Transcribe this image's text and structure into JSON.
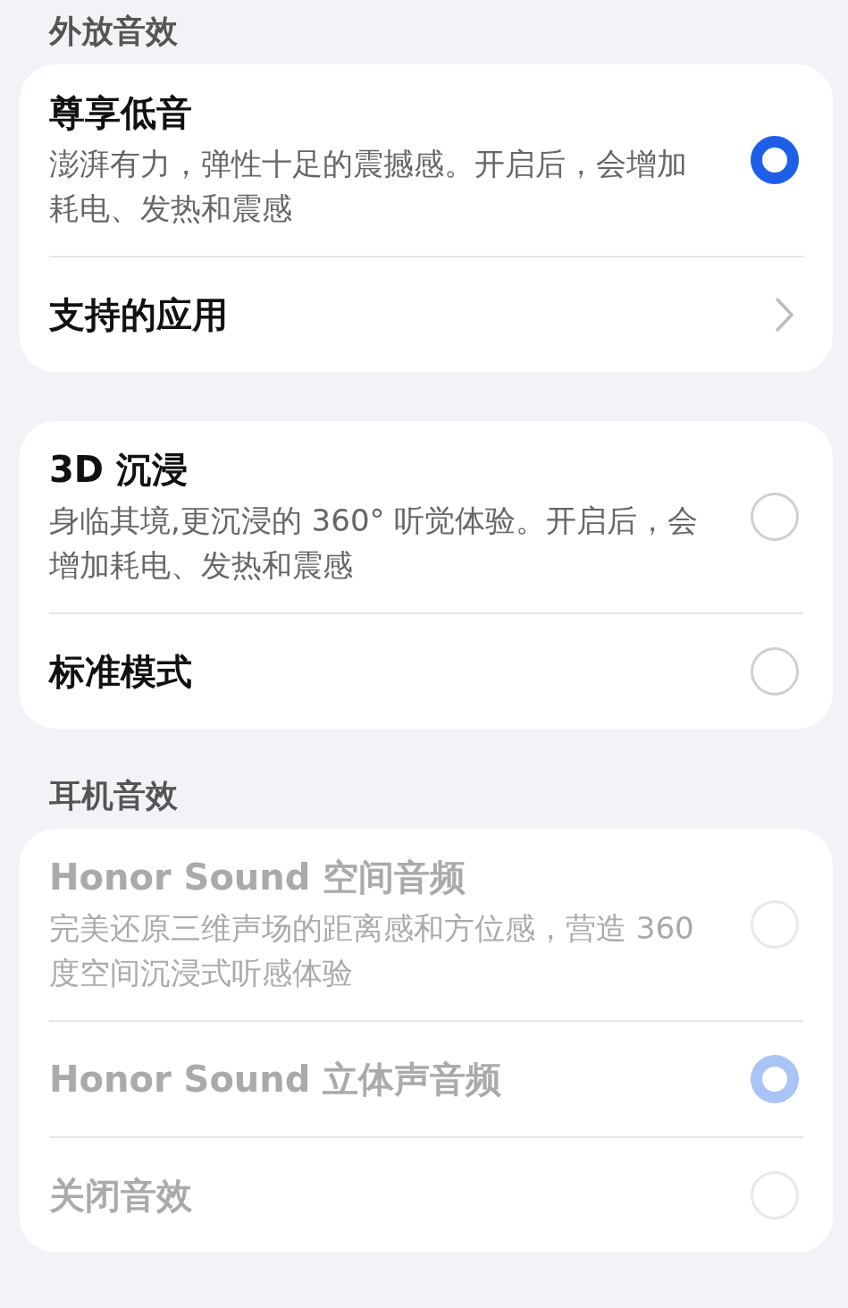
{
  "sections": [
    {
      "title": "外放音效",
      "cards": [
        {
          "items": [
            {
              "kind": "radio",
              "title": "尊享低音",
              "description": "澎湃有力，弹性十足的震撼感。开启后，会增加耗电、发热和震感",
              "selected": true,
              "disabled": false
            },
            {
              "kind": "link",
              "title": "支持的应用",
              "disabled": false
            }
          ]
        },
        {
          "items": [
            {
              "kind": "radio",
              "title": "3D 沉浸",
              "description": "身临其境,更沉浸的 360° 听觉体验。开启后，会增加耗电、发热和震感",
              "selected": false,
              "disabled": false
            },
            {
              "kind": "radio",
              "title": "标准模式",
              "selected": false,
              "disabled": false
            }
          ]
        }
      ]
    },
    {
      "title": "耳机音效",
      "cards": [
        {
          "items": [
            {
              "kind": "radio",
              "title": "Honor Sound 空间音频",
              "description": "完美还原三维声场的距离感和方位感，营造 360 度空间沉浸式听感体验",
              "selected": false,
              "disabled": true
            },
            {
              "kind": "radio",
              "title": "Honor Sound 立体声音频",
              "selected": true,
              "disabled": true
            },
            {
              "kind": "radio",
              "title": "关闭音效",
              "selected": false,
              "disabled": true
            }
          ]
        }
      ]
    }
  ]
}
